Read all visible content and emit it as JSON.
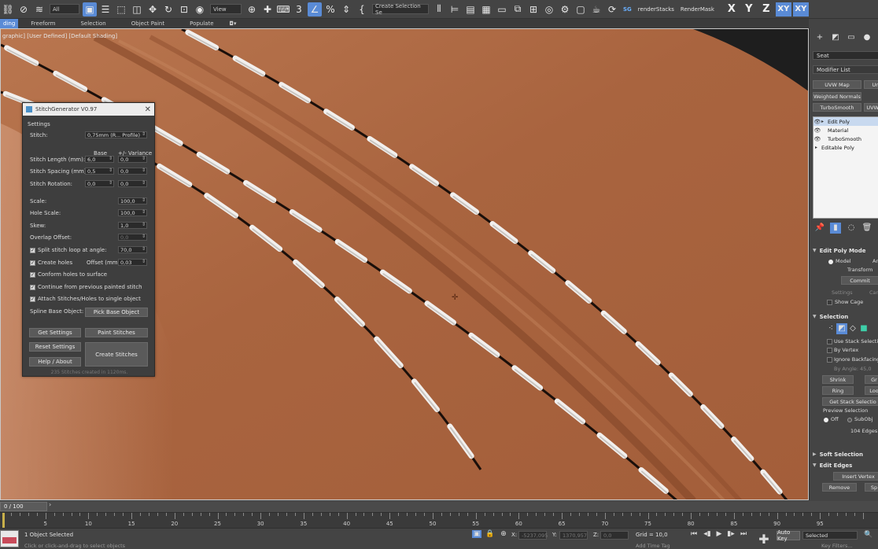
{
  "toolbar": {
    "filter_dropdown": "All",
    "view_dropdown": "View",
    "selection_set_dropdown": "Create Selection Se",
    "render_stacks": "renderStacks",
    "render_mask": "RenderMask",
    "axes": [
      "X",
      "Y",
      "Z",
      "XY",
      "XY"
    ],
    "sg_badge": "SG"
  },
  "ribbon": {
    "tabs": [
      "ding",
      "Freeform",
      "Selection",
      "Object Paint",
      "Populate"
    ]
  },
  "viewport": {
    "label": "graphic] [User Defined] [Default Shading]"
  },
  "stitch_generator": {
    "title": "StitchGenerator V0.97",
    "settings_header": "Settings",
    "stitch_label": "Stitch:",
    "stitch_value": "0,75mm (R... Profile)",
    "col_base": "Base",
    "col_variance": "+/- Variance",
    "stitch_length_label": "Stitch Length (mm):",
    "stitch_length_base": "6,0",
    "stitch_length_var": "0,0",
    "stitch_spacing_label": "Stitch Spacing (mm):",
    "stitch_spacing_base": "0,5",
    "stitch_spacing_var": "0,0",
    "stitch_rotation_label": "Stitch Rotation:",
    "stitch_rotation_base": "0,0",
    "stitch_rotation_var": "0,0",
    "scale_label": "Scale:",
    "scale_value": "100,0",
    "hole_scale_label": "Hole Scale:",
    "hole_scale_value": "100,0",
    "skew_label": "Skew:",
    "skew_value": "1,0",
    "overlap_label": "Overlap Offset:",
    "overlap_value": "0,0",
    "split_loop_label": "Split stitch loop at angle:",
    "split_loop_value": "70,0",
    "create_holes_label": "Create holes",
    "offset_label": "Offset (mm):",
    "offset_value": "0,03",
    "conform_label": "Conform holes to surface",
    "continue_label": "Continue from previous painted stitch",
    "attach_label": "Attach Stitches/Holes to single object",
    "spline_label": "Spline Base Object:",
    "pick_base": "Pick Base Object",
    "get_settings": "Get Settings",
    "paint_stitches": "Paint Stitches",
    "reset_settings": "Reset Settings",
    "create_stitches": "Create Stitches",
    "help_about": "Help / About",
    "status": "235 Stitches created in 1120ms."
  },
  "command_panel": {
    "object_name": "Seat",
    "modifier_list": "Modifier List",
    "mod_buttons": [
      "UVW Map",
      "Un",
      "Weighted Normals",
      "TurboSmooth",
      "UVW M"
    ],
    "stack": [
      "Edit Poly",
      "Material",
      "TurboSmooth",
      "Editable Poly"
    ],
    "edit_poly_mode": "Edit Poly Mode",
    "model_label": "Model",
    "anim_label": "An",
    "transform_label": "Transform",
    "commit_label": "Commit",
    "settings_label": "Settings",
    "cancel_label": "Can",
    "show_cage": "Show Cage",
    "selection_header": "Selection",
    "use_stack_selection": "Use Stack Selection",
    "by_vertex": "By Vertex",
    "ignore_backfacing": "Ignore Backfacing",
    "by_angle_label": "By Angle:",
    "by_angle_value": "45,0",
    "shrink": "Shrink",
    "grow": "Gr",
    "ring": "Ring",
    "loop": "Loo",
    "get_stack_selection": "Get Stack Selectio",
    "preview_selection": "Preview Selection",
    "off_label": "Off",
    "subobj_label": "SubObj",
    "edges_selected": "104 Edges S",
    "soft_selection": "Soft Selection",
    "edit_edges": "Edit Edges",
    "insert_vertex": "Insert Vertex",
    "remove": "Remove",
    "split": "Sp"
  },
  "timeline": {
    "frame_display": "0 / 100",
    "ticks": [
      5,
      10,
      15,
      20,
      25,
      30,
      35,
      40,
      45,
      50,
      55,
      60,
      65,
      70,
      75,
      80,
      85,
      90,
      95
    ]
  },
  "status_bar": {
    "selection_text": "1 Object Selected",
    "hint_text": "Click or click-and-drag to select objects",
    "x_label": "X:",
    "x_value": "-5237,095",
    "y_label": "Y:",
    "y_value": "1370,957",
    "z_label": "Z:",
    "z_value": "0,0",
    "grid_text": "Grid = 10,0",
    "add_time_tag": "Add Time Tag",
    "auto_key": "Auto Key",
    "selected_dropdown": "Selected",
    "key_filters": "Key Filters..."
  }
}
